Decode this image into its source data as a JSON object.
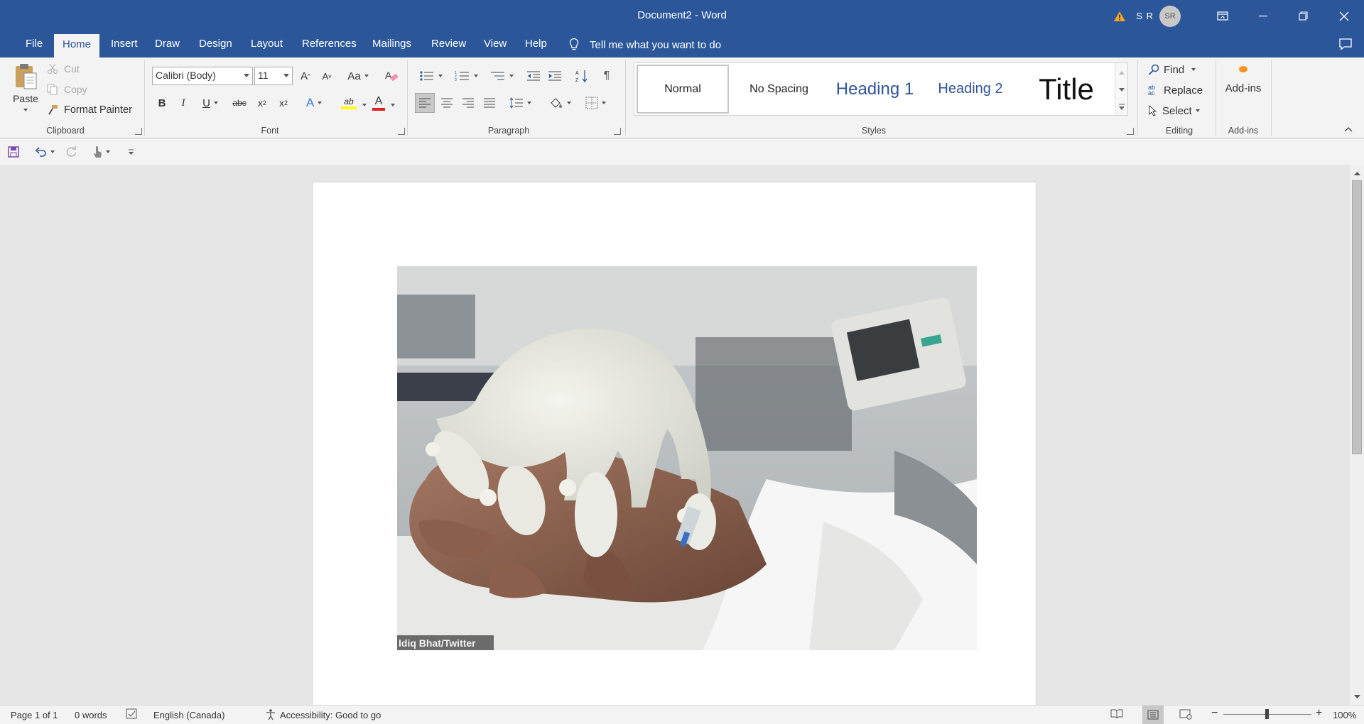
{
  "titlebar": {
    "title": "Document2  -  Word",
    "user_initials": "S R",
    "avatar_text": "SR",
    "icons": [
      "warning-icon",
      "ribbon-display-icon",
      "minimize-icon",
      "restore-icon",
      "close-icon"
    ]
  },
  "tabs": [
    {
      "label": "File"
    },
    {
      "label": "Home",
      "active": true
    },
    {
      "label": "Insert"
    },
    {
      "label": "Draw"
    },
    {
      "label": "Design"
    },
    {
      "label": "Layout"
    },
    {
      "label": "References"
    },
    {
      "label": "Mailings"
    },
    {
      "label": "Review"
    },
    {
      "label": "View"
    },
    {
      "label": "Help"
    }
  ],
  "tellme": {
    "text": "Tell me what you want to do"
  },
  "ribbon": {
    "clipboard": {
      "label": "Clipboard",
      "paste": "Paste",
      "cut": "Cut",
      "copy": "Copy",
      "format_painter": "Format Painter"
    },
    "font": {
      "label": "Font",
      "font_name": "Calibri (Body)",
      "font_size": "11",
      "grow": "A",
      "shrink": "A",
      "change_case": "Aa",
      "bold": "B",
      "italic": "I",
      "underline": "U",
      "strike": "abc",
      "subscript": "x",
      "sub_mark": "2",
      "superscript": "x",
      "sup_mark": "2",
      "text_effects": "A",
      "highlight": "ab",
      "font_color": "A",
      "font_color_hex": "#e02020",
      "highlight_hex": "#ffff00"
    },
    "paragraph": {
      "label": "Paragraph",
      "pilcrow": "¶"
    },
    "styles": {
      "label": "Styles",
      "items": [
        {
          "label": "Normal"
        },
        {
          "label": "No Spacing"
        },
        {
          "label": "Heading 1"
        },
        {
          "label": "Heading 2"
        },
        {
          "label": "Title"
        }
      ]
    },
    "editing": {
      "label": "Editing",
      "find": "Find",
      "replace": "Replace",
      "select": "Select",
      "replace_abc": "ab",
      "replace_ac": "ac"
    },
    "addins": {
      "label": "Add-ins",
      "button": "Add-ins",
      "accent_hex": "#f7941d"
    }
  },
  "qat": {
    "icons": [
      "save-icon",
      "undo-icon",
      "redo-icon",
      "touch-mode-icon",
      "customize-icon"
    ]
  },
  "document": {
    "image_caption": "ldiq Bhat/Twitter"
  },
  "statusbar": {
    "page": "Page 1 of 1",
    "words": "0 words",
    "language": "English (Canada)",
    "accessibility": "Accessibility: Good to go",
    "zoom": "100%"
  },
  "colors": {
    "brand": "#2b579a",
    "ribbon_bg": "#f3f3f3",
    "canvas_bg": "#e6e6e6"
  }
}
